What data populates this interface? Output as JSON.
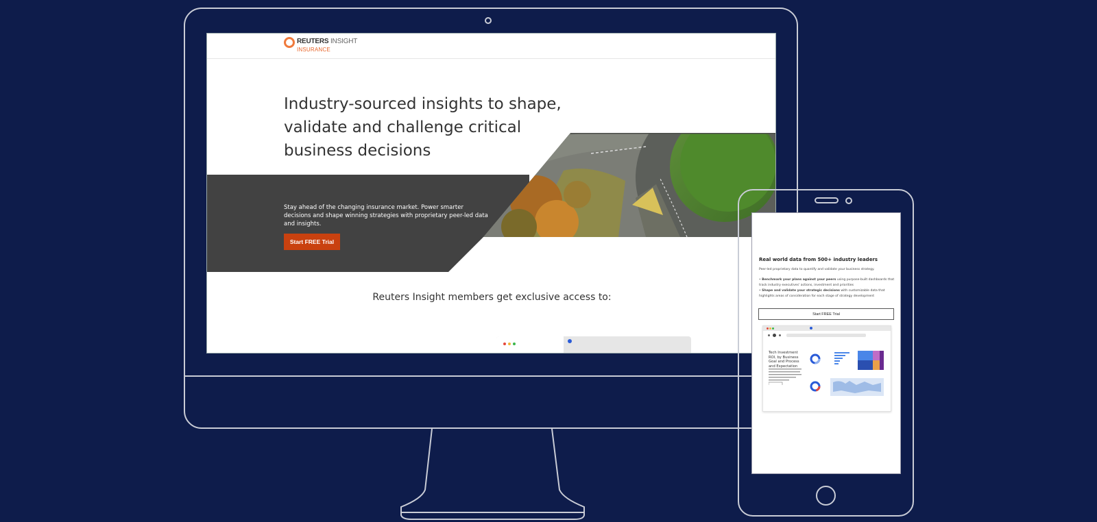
{
  "desktop": {
    "logo": {
      "brand_bold": "REUTERS",
      "brand_light": " INSIGHT",
      "product": "INSURANCE"
    },
    "hero": {
      "title": "Industry-sourced insights to shape, validate and challenge critical business decisions",
      "description": "Stay ahead of the changing insurance market. Power smarter decisions and shape winning strategies with proprietary peer-led data and insights.",
      "cta_label": "Start FREE Trial"
    },
    "members_heading": "Reuters Insight members get exclusive access to:"
  },
  "mobile": {
    "title": "Real world data from 500+ industry leaders",
    "subtitle": "Peer-led proprietary data to quantify and validate your business strategy.",
    "bullets": [
      {
        "bold": "Benchmark your plans against your peers",
        "text": " using purpose-built dashboards that track industry executives' actions, investment and priorities"
      },
      {
        "bold": "Shape and validate your strategic decisions",
        "text": " with customizable data that highlights areas of consideration for each stage of strategy development"
      }
    ],
    "cta_label": "Start FREE Trial",
    "preview_card": {
      "title": "Tech Investment ROI, by Business Goal and Process and Expectation"
    }
  },
  "colors": {
    "background": "#0e1c4b",
    "device_outline": "#c9ccd6",
    "cta": "#c9410f",
    "logo_accent": "#f07a3c",
    "hero_panel": "#424242"
  }
}
